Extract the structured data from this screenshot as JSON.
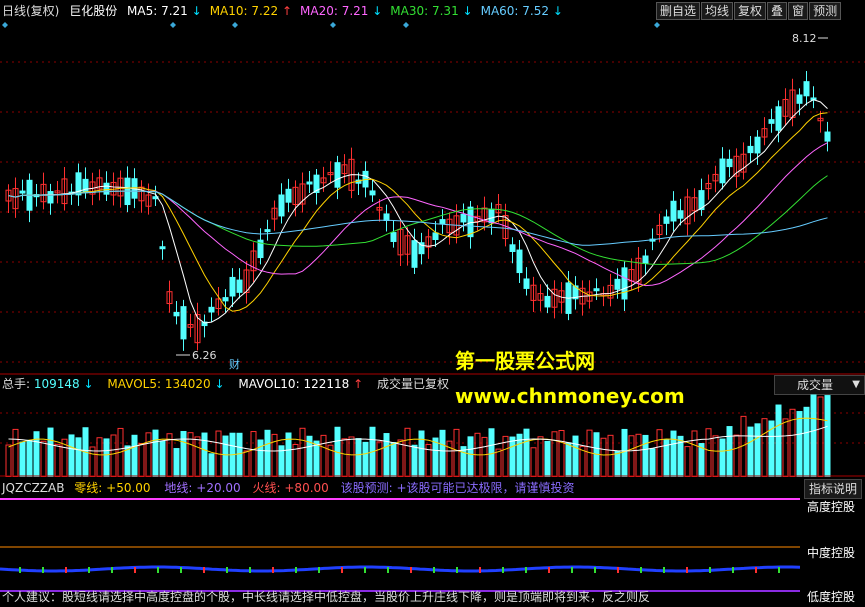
{
  "header": {
    "period": "日线(复权)",
    "stock": "巨化股份",
    "ma": [
      {
        "label": "MA5: 7.21",
        "arrow": "↓",
        "color": "#ffffff",
        "arrow_color": "#00e0ff"
      },
      {
        "label": "MA10: 7.22",
        "arrow": "↑",
        "color": "#ffd200",
        "arrow_color": "#ff4040"
      },
      {
        "label": "MA20: 7.21",
        "arrow": "↓",
        "color": "#ff66ff",
        "arrow_color": "#00e0ff"
      },
      {
        "label": "MA30: 7.31",
        "arrow": "↓",
        "color": "#33e033",
        "arrow_color": "#00e0ff"
      },
      {
        "label": "MA60: 7.52",
        "arrow": "↓",
        "color": "#66ccff",
        "arrow_color": "#00e0ff"
      }
    ],
    "toolbar": [
      "删自选",
      "均线",
      "复权",
      "叠",
      "窗",
      "预测"
    ]
  },
  "price_chart": {
    "high_label": "8.12",
    "low_label": "6.26",
    "finance_mark": "财",
    "watermark_title": "第一股票公式网",
    "watermark_url": "www.chnmoney.com"
  },
  "volume_panel": {
    "total": {
      "label": "总手:",
      "value": "109148",
      "arrow": "↓"
    },
    "mavol5": {
      "label": "MAVOL5:",
      "value": "134020",
      "arrow": "↓"
    },
    "mavol10": {
      "label": "MAVOL10:",
      "value": "122118",
      "arrow": "↑"
    },
    "note": "成交量已复权",
    "selector": "成交量"
  },
  "indicator_panel": {
    "name": "JQZCZZAB",
    "zero": "零线: +50.00",
    "earth": "地线: +20.00",
    "fire": "火线: +80.00",
    "predict_label": "该股预测:",
    "predict_text": "+该股可能已达极限，请谨慎投资",
    "help_button": "指标说明",
    "level_high": "高度控股",
    "level_mid": "中度控股",
    "level_low": "低度控股",
    "advice": "个人建议：股短线请选择中高度控盘的个股，中长线请选择中低控盘，当股价上升庄线下降，则是顶端即将到来，反之则反"
  },
  "colors": {
    "up": "#ff3030",
    "down": "#54ffff",
    "ma5": "#ffffff",
    "ma10": "#ffd200",
    "ma20": "#ff66ff",
    "ma30": "#33e033",
    "ma60": "#66ccff",
    "grid": "#8b0000"
  }
}
